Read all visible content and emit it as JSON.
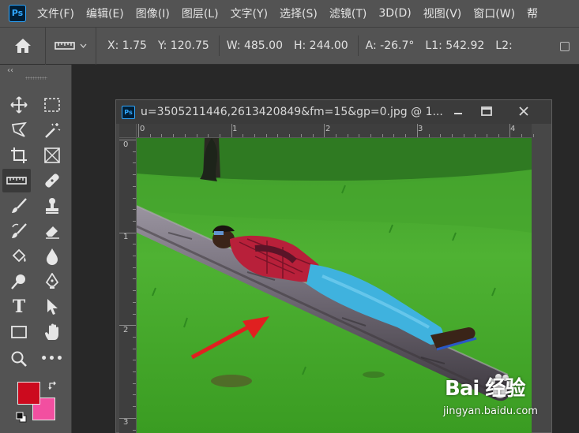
{
  "app": {
    "logo": "Ps"
  },
  "menubar": {
    "items": [
      "文件(F)",
      "编辑(E)",
      "图像(I)",
      "图层(L)",
      "文字(Y)",
      "选择(S)",
      "滤镜(T)",
      "3D(D)",
      "视图(V)",
      "窗口(W)",
      "帮"
    ]
  },
  "options": {
    "home_icon": "home-icon",
    "tool_preset_icon": "ruler-icon",
    "x": "X:  1.75",
    "y": "Y:  120.75",
    "w": "W:  485.00",
    "h": "H:  244.00",
    "a": "A:  -26.7°",
    "l1": "L1:  542.92",
    "l2": "L2:"
  },
  "tools": {
    "collapse": "‹‹",
    "items": [
      "move-tool",
      "marquee-tool",
      "lasso-tool",
      "magic-wand-tool",
      "crop-tool",
      "frame-tool",
      "ruler-tool",
      "healing-brush-tool",
      "brush-tool",
      "clone-stamp-tool",
      "history-brush-tool",
      "eraser-tool",
      "paint-bucket-tool",
      "blur-tool",
      "dodge-tool",
      "pen-tool",
      "type-tool",
      "path-selection-tool",
      "rectangle-tool",
      "hand-tool",
      "zoom-tool",
      "more-tools"
    ],
    "selected": "ruler-tool",
    "type_label": "T",
    "more_label": "•••",
    "foreground_color": "#cc0a1e",
    "background_color": "#f24fa0"
  },
  "document": {
    "logo": "Ps",
    "title": "u=3505211446,2613420849&fm=15&gp=0.jpg @ 1...",
    "ruler_top_labels": [
      "0",
      "1",
      "2",
      "3",
      "4"
    ],
    "ruler_left_labels": [
      "0",
      "1",
      "2",
      "3"
    ]
  },
  "watermark": {
    "brand": "Bai 经验",
    "url": "jingyan.baidu.com"
  }
}
